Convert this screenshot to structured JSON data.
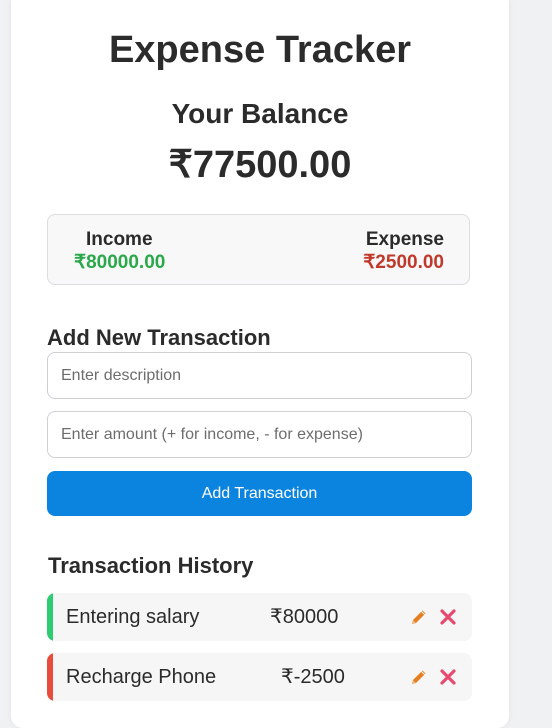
{
  "app": {
    "title": "Expense Tracker"
  },
  "balance": {
    "label": "Your Balance",
    "amount": "₹77500.00"
  },
  "summary": {
    "income_label": "Income",
    "income_value": "₹80000.00",
    "expense_label": "Expense",
    "expense_value": "₹2500.00"
  },
  "form": {
    "heading": "Add New Transaction",
    "description_placeholder": "Enter description",
    "description_value": "",
    "amount_placeholder": "Enter amount (+ for income, - for expense)",
    "amount_value": "",
    "submit_label": "Add Transaction"
  },
  "history": {
    "heading": "Transaction History",
    "items": [
      {
        "description": "Entering salary",
        "amount": "₹80000",
        "type": "income",
        "edit_icon": "pencil-icon",
        "delete_icon": "cross-icon"
      },
      {
        "description": "Recharge Phone",
        "amount": "₹-2500",
        "type": "expense",
        "edit_icon": "pencil-icon",
        "delete_icon": "cross-icon"
      }
    ]
  },
  "colors": {
    "accent": "#0b84e0",
    "income": "#2aa84a",
    "expense": "#c0392b",
    "income_bar": "#2ecc71",
    "expense_bar": "#e74c3c",
    "edit_icon": "#e67e22",
    "delete_icon": "#e84a6f"
  }
}
